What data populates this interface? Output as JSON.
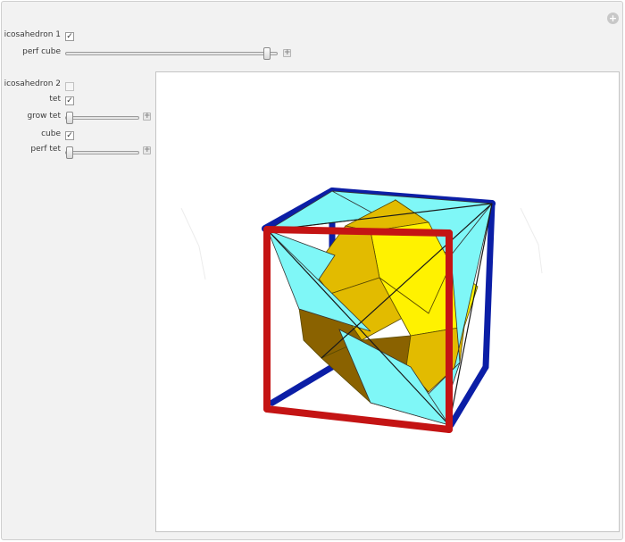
{
  "controls": {
    "ico1_label": "icosahedron 1",
    "ico1_checked": true,
    "perf_cube_label": "perf cube",
    "perf_cube_value": 0.97,
    "ico2_label": "icosahedron 2",
    "ico2_checked": false,
    "tet_label": "tet",
    "tet_checked": true,
    "grow_tet_label": "grow tet",
    "grow_tet_value": 0.0,
    "cube_label": "cube",
    "cube_checked": true,
    "perf_tet_label": "perf tet",
    "perf_tet_value": 0.0
  },
  "icons": {
    "reset": "plus-circle-icon",
    "checkmark": "✓",
    "plus": "+"
  },
  "colors": {
    "cube_front": "#c41414",
    "cube_back": "#0b1ea6",
    "tetrahedron": "#7ff7f7",
    "icosahedron_light": "#fff200",
    "icosahedron_mid": "#e2bb00",
    "icosahedron_dark": "#8a6200"
  }
}
